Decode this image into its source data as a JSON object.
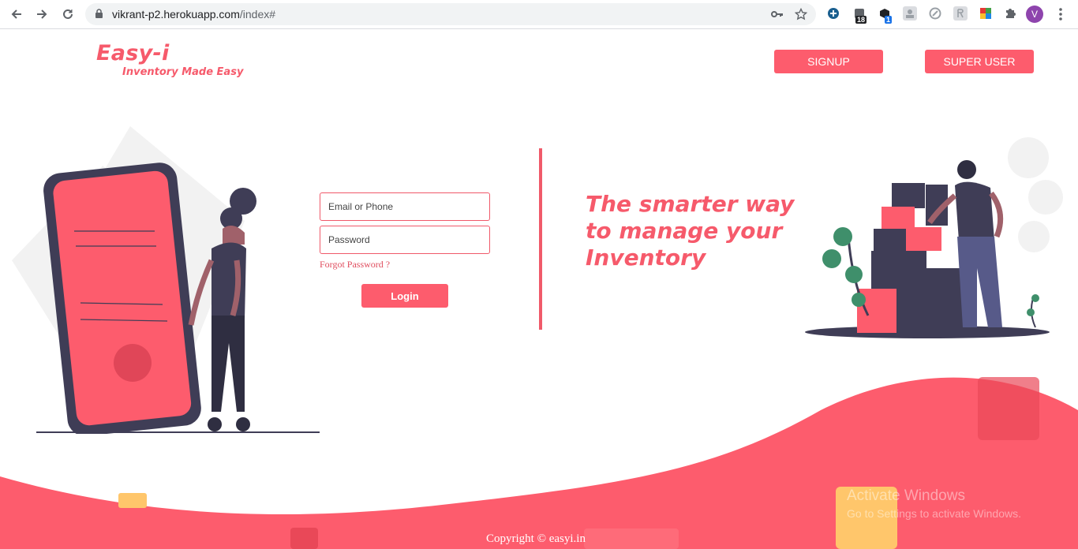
{
  "browser": {
    "url_host": "vikrant-p2.herokuapp.com",
    "url_path": "/index#",
    "extension_badges": [
      "18",
      "1"
    ],
    "profile_initial": "V"
  },
  "header": {
    "logo_title": "Easy-i",
    "logo_tagline": "Inventory Made Easy",
    "signup_label": "SIGNUP",
    "super_user_label": "SUPER USER"
  },
  "login": {
    "email_placeholder": "Email or Phone",
    "password_placeholder": "Password",
    "forgot_label": "Forgot Password ?",
    "login_label": "Login"
  },
  "hero": {
    "tagline_line1": "The smarter way",
    "tagline_line2": "to manage your",
    "tagline_line3": "Inventory"
  },
  "footer": {
    "copyright": "Copyright © easyi.in"
  },
  "watermark": {
    "title": "Activate Windows",
    "subtitle": "Go to Settings to activate Windows."
  },
  "colors": {
    "accent": "#fd5c6d",
    "dark": "#3f3d56"
  }
}
